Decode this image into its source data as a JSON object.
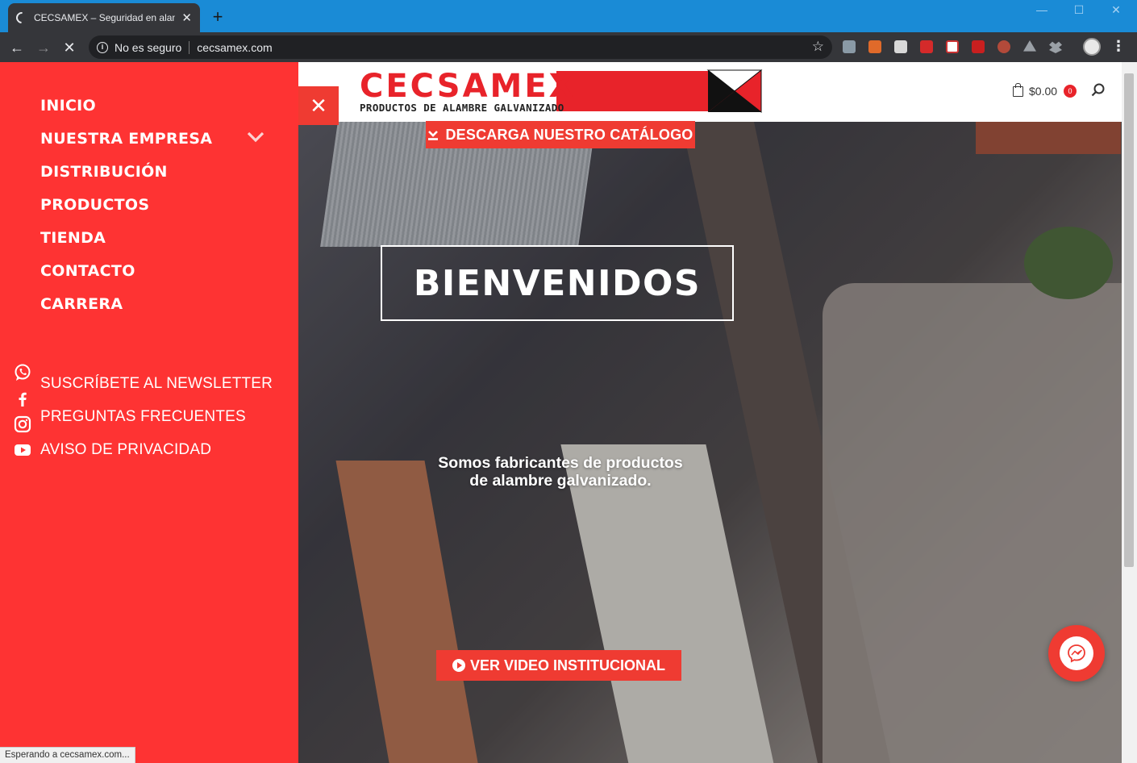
{
  "browser": {
    "tab_title": "CECSAMEX – Seguridad en alambre",
    "tab_close": "✕",
    "new_tab": "+",
    "security_label": "No es seguro",
    "url": "cecsamex.com",
    "status_text": "Esperando a cecsamex.com..."
  },
  "site": {
    "logo_text": "CECSAMEX",
    "logo_subtitle": "PRODUCTOS DE ALAMBRE GALVANIZADO",
    "cart_total": "$0.00",
    "cart_count": "0",
    "close_menu_symbol": "✕"
  },
  "menu": {
    "items": [
      {
        "label": "INICIO"
      },
      {
        "label": "NUESTRA EMPRESA"
      },
      {
        "label": "DISTRIBUCIÓN"
      },
      {
        "label": "PRODUCTOS"
      },
      {
        "label": "TIENDA"
      },
      {
        "label": "CONTACTO"
      },
      {
        "label": "CARRERA"
      }
    ],
    "secondary": [
      {
        "label": "SUSCRÍBETE AL NEWSLETTER"
      },
      {
        "label": "PREGUNTAS FRECUENTES"
      },
      {
        "label": "AVISO DE PRIVACIDAD"
      }
    ],
    "social_icons": [
      "whatsapp-icon",
      "facebook-icon",
      "instagram-icon",
      "youtube-icon"
    ]
  },
  "hero": {
    "catalog_button": "DESCARGA NUESTRO CATÁLOGO",
    "welcome": "BIENVENIDOS",
    "tagline_line1": "Somos fabricantes de productos",
    "tagline_line2": "de alambre galvanizado.",
    "video_button": "VER VIDEO INSTITUCIONAL"
  },
  "colors": {
    "brand_red": "#e8232a",
    "menu_red": "#fe3333",
    "titlebar_blue": "#1a8bd6"
  }
}
